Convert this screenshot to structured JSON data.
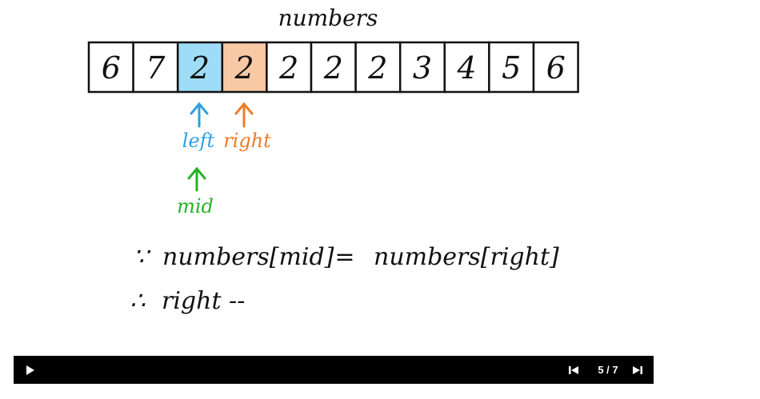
{
  "title": "numbers",
  "array": {
    "values": [
      "6",
      "7",
      "2",
      "2",
      "2",
      "2",
      "2",
      "3",
      "4",
      "5",
      "6"
    ],
    "highlight": {
      "2": "#9fdcf8",
      "3": "#f9c8a4"
    }
  },
  "pointers": {
    "left": {
      "label": "left",
      "color": "#2e9fe0"
    },
    "right": {
      "label": "right",
      "color": "#f07b28"
    },
    "mid": {
      "label": "mid",
      "color": "#24b324"
    }
  },
  "reasoning": {
    "line1": {
      "because": "∵",
      "lhs": "numbers[mid]",
      "op": "=",
      "rhs": "numbers[right]"
    },
    "line2": {
      "therefore": "∴",
      "action": "right --"
    }
  },
  "player": {
    "counter": "5 / 7",
    "play_icon": "play-icon",
    "prev_icon": "skip-previous-icon",
    "next_icon": "skip-next-icon"
  }
}
